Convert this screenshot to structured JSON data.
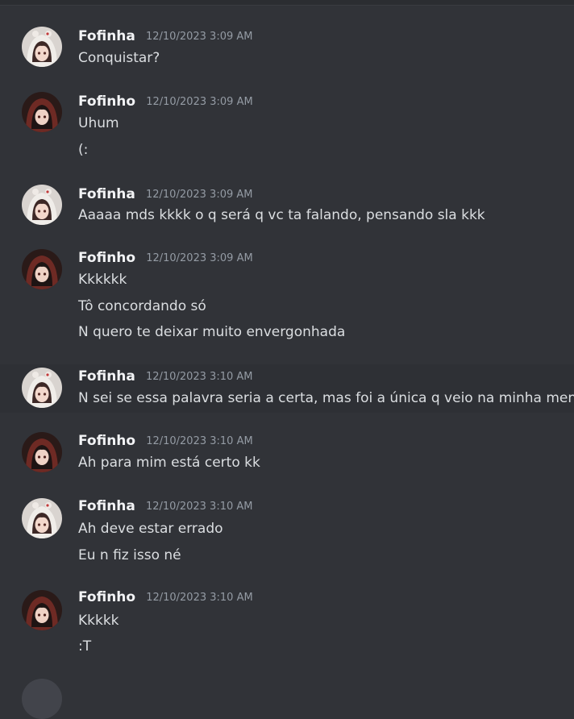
{
  "messages": [
    {
      "author": "Fofinha",
      "timestamp": "12/10/2023 3:09 AM",
      "avatar": "fofinha-avatar",
      "lines": [
        "Conquistar?"
      ]
    },
    {
      "author": "Fofinho",
      "timestamp": "12/10/2023 3:09 AM",
      "avatar": "fofinho-avatar",
      "lines": [
        "Uhum",
        "(:"
      ]
    },
    {
      "author": "Fofinha",
      "timestamp": "12/10/2023 3:09 AM",
      "avatar": "fofinha-avatar",
      "lines": [
        "Aaaaa mds kkkk o q será q vc ta falando, pensando sla kkk"
      ]
    },
    {
      "author": "Fofinho",
      "timestamp": "12/10/2023 3:09 AM",
      "avatar": "fofinho-avatar",
      "lines": [
        "Kkkkkk",
        "Tô concordando só",
        "N quero te deixar muito envergonhada"
      ]
    },
    {
      "author": "Fofinha",
      "timestamp": "12/10/2023 3:10 AM",
      "avatar": "fofinha-avatar",
      "lines": [
        "N sei se essa palavra seria a certa, mas foi a única q veio na minha mente"
      ]
    },
    {
      "author": "Fofinho",
      "timestamp": "12/10/2023 3:10 AM",
      "avatar": "fofinho-avatar",
      "lines": [
        "Ah para mim está certo kk"
      ]
    },
    {
      "author": "Fofinha",
      "timestamp": "12/10/2023 3:10 AM",
      "avatar": "fofinha-avatar",
      "lines": [
        "Ah deve estar errado",
        "Eu n fiz isso né"
      ]
    },
    {
      "author": "Fofinho",
      "timestamp": "12/10/2023 3:10 AM",
      "avatar": "fofinho-avatar",
      "lines": [
        "Kkkkk",
        ":T"
      ]
    }
  ],
  "colors": {
    "background": "#313338",
    "username": "#f2f3f5",
    "timestamp": "#949ba4",
    "message_text": "#dbdee1"
  }
}
